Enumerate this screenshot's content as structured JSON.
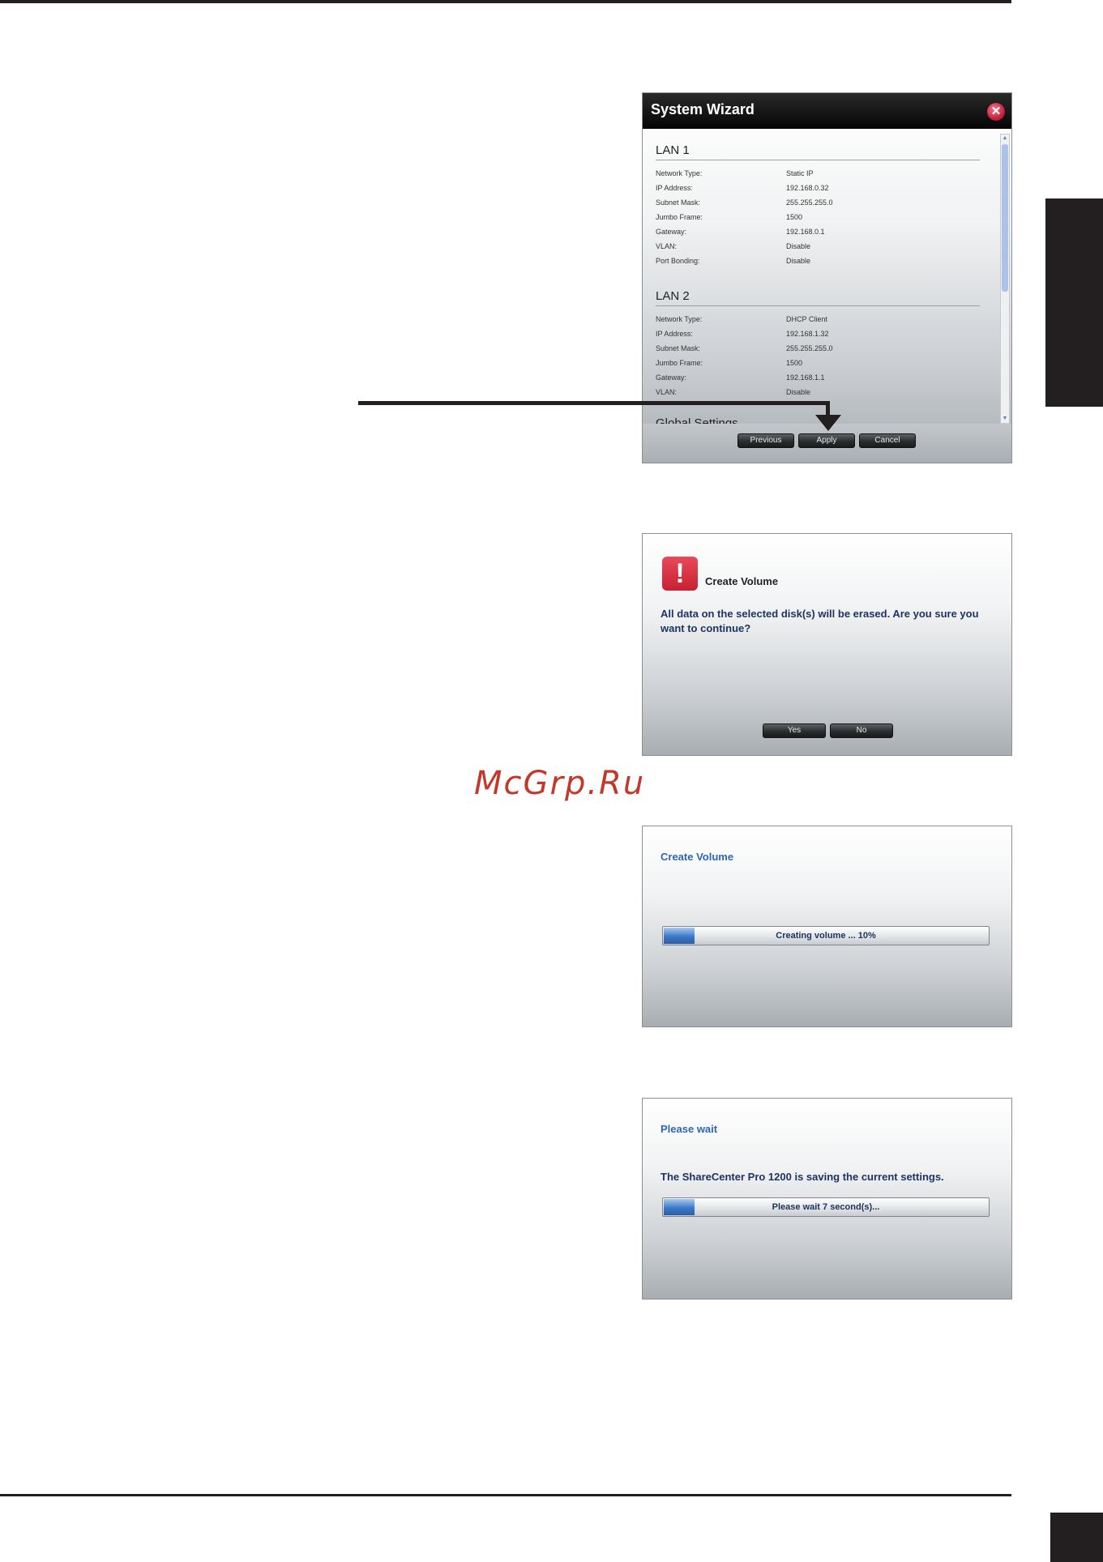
{
  "watermark": "McGrp.Ru",
  "wizard": {
    "title": "System Wizard",
    "close_glyph": "✕",
    "lan1": {
      "title": "LAN 1",
      "rows": [
        {
          "label": "Network Type:",
          "value": "Static IP"
        },
        {
          "label": "IP Address:",
          "value": "192.168.0.32"
        },
        {
          "label": "Subnet Mask:",
          "value": "255.255.255.0"
        },
        {
          "label": "Jumbo Frame:",
          "value": "1500"
        },
        {
          "label": "Gateway:",
          "value": "192.168.0.1"
        },
        {
          "label": "VLAN:",
          "value": "Disable"
        },
        {
          "label": "Port Bonding:",
          "value": "Disable"
        }
      ]
    },
    "lan2": {
      "title": "LAN 2",
      "rows": [
        {
          "label": "Network Type:",
          "value": "DHCP Client"
        },
        {
          "label": "IP Address:",
          "value": "192.168.1.32"
        },
        {
          "label": "Subnet Mask:",
          "value": "255.255.255.0"
        },
        {
          "label": "Jumbo Frame:",
          "value": "1500"
        },
        {
          "label": "Gateway:",
          "value": "192.168.1.1"
        },
        {
          "label": "VLAN:",
          "value": "Disable"
        }
      ]
    },
    "global_title": "Global Settings",
    "buttons": {
      "previous": "Previous",
      "apply": "Apply",
      "cancel": "Cancel"
    }
  },
  "confirm": {
    "title": "Create Volume",
    "message": "All data on the selected disk(s) will be erased. Are you sure you want to continue?",
    "buttons": {
      "yes": "Yes",
      "no": "No"
    }
  },
  "progress": {
    "title": "Create Volume",
    "bar_label": "Creating volume ... 10%",
    "progress_fraction": 0.1
  },
  "wait": {
    "title": "Please wait",
    "message": "The ShareCenter Pro 1200 is saving the current settings.",
    "bar_label": "Please wait 7 second(s)...",
    "progress_fraction": 0.1
  },
  "icons": {
    "warning": "exclamation-icon",
    "close": "close-icon"
  },
  "colors": {
    "accent_blue": "#2f66b3",
    "warning_red": "#c81f33",
    "page_black": "#231f20"
  }
}
